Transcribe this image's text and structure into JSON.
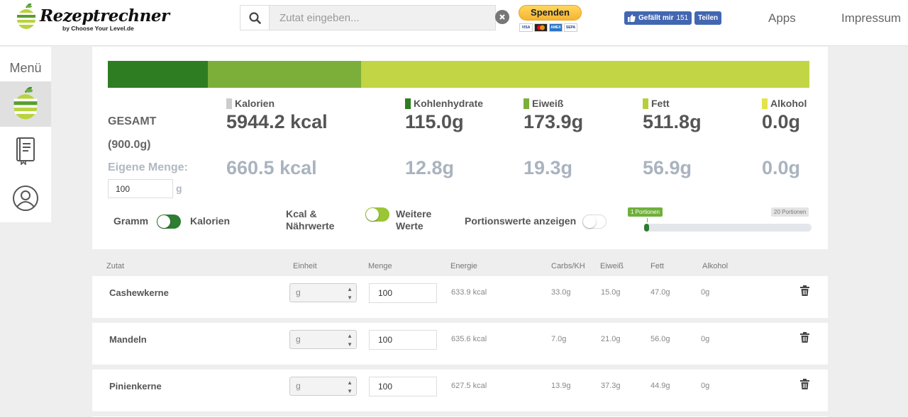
{
  "header": {
    "logo_text": "Rezeptrechner",
    "logo_subtitle": "by Choose Your Level.de",
    "search_placeholder": "Zutat eingeben...",
    "donate_label": "Spenden",
    "payment_cards": [
      "VISA",
      "MC",
      "AMEX",
      "SEPA"
    ],
    "fb_like_label": "Gefällt mir",
    "fb_like_count": "151",
    "fb_share_label": "Teilen",
    "nav": {
      "apps": "Apps",
      "impressum": "Impressum"
    }
  },
  "sidebar": {
    "menu_label": "Menü",
    "items": [
      {
        "icon": "apple-logo-icon",
        "active": true
      },
      {
        "icon": "recipe-book-icon",
        "active": false
      },
      {
        "icon": "user-profile-icon",
        "active": false
      }
    ]
  },
  "summary": {
    "macro_bar": [
      {
        "name": "Kohlenhydrate",
        "fraction": 0.143,
        "color": "#2e7d22"
      },
      {
        "name": "Eiweiß",
        "fraction": 0.218,
        "color": "#7caf3a"
      },
      {
        "name": "Fett",
        "fraction": 0.639,
        "color": "#c2d544"
      }
    ],
    "total_label": "GESAMT",
    "total_weight": "(900.0g)",
    "own_amount_label": "Eigene Menge:",
    "own_amount_value": "100",
    "own_amount_unit": "g",
    "columns": [
      {
        "label": "Kalorien",
        "color": "#cccccc",
        "total": "5944.2 kcal",
        "own": "660.5 kcal"
      },
      {
        "label": "Kohlenhydrate",
        "color": "#2e7d22",
        "total": "115.0g",
        "own": "12.8g"
      },
      {
        "label": "Eiweiß",
        "color": "#7caf3a",
        "total": "173.9g",
        "own": "19.3g"
      },
      {
        "label": "Fett",
        "color": "#b5cf3c",
        "total": "511.8g",
        "own": "56.9g"
      },
      {
        "label": "Alkohol",
        "color": "#e3e34a",
        "total": "0.0g",
        "own": "0.0g"
      }
    ],
    "toggles": {
      "gramm": "Gramm",
      "kalorien": "Kalorien",
      "kcal_naehrwerte": [
        "Kcal &",
        "Nährwerte"
      ],
      "weitere_werte": [
        "Weitere",
        "Werte"
      ],
      "portionswerte": "Portionswerte anzeigen"
    },
    "portions": {
      "start_label": "1 Portionen",
      "end_label": "20 Portionen",
      "value": 1,
      "min": 1,
      "max": 20
    }
  },
  "table": {
    "headers": [
      "Zutat",
      "Einheit",
      "Menge",
      "Energie",
      "Carbs/KH",
      "Eiweiß",
      "Fett",
      "Alkohol"
    ],
    "rows": [
      {
        "name": "Cashewkerne",
        "unit": "g",
        "qty": "100",
        "energy": "633.9 kcal",
        "carbs": "33.0g",
        "protein": "15.0g",
        "fat": "47.0g",
        "alcohol": "0g"
      },
      {
        "name": "Mandeln",
        "unit": "g",
        "qty": "100",
        "energy": "635.6 kcal",
        "carbs": "7.0g",
        "protein": "21.0g",
        "fat": "56.0g",
        "alcohol": "0g"
      },
      {
        "name": "Pinienkerne",
        "unit": "g",
        "qty": "100",
        "energy": "627.5 kcal",
        "carbs": "13.9g",
        "protein": "37.3g",
        "fat": "44.9g",
        "alcohol": "0g"
      }
    ]
  }
}
